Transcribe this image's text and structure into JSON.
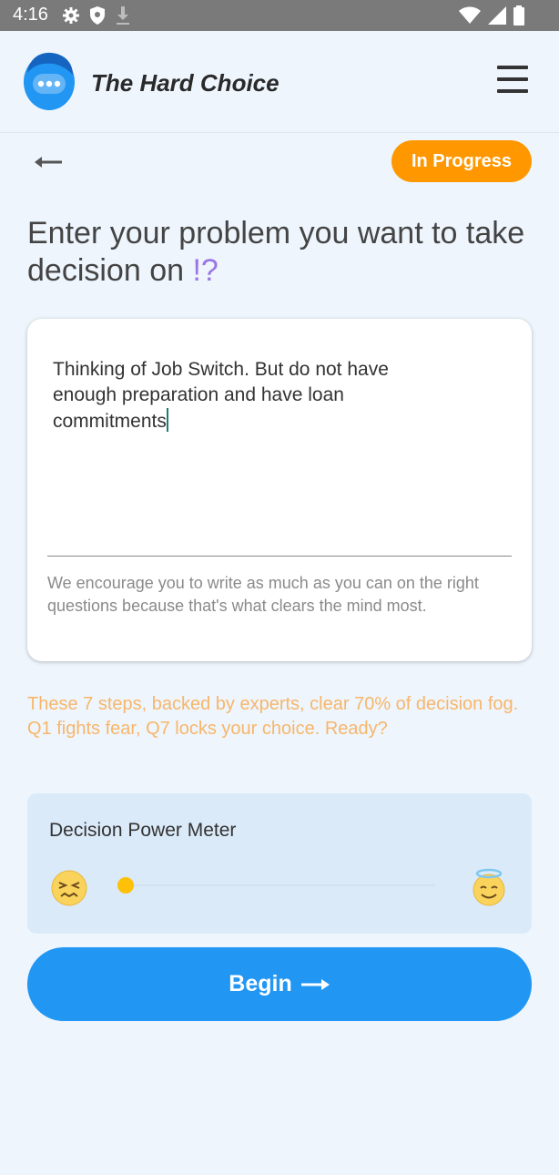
{
  "status_bar": {
    "time": "4:16",
    "icons_left": [
      "gear-icon",
      "shield-icon",
      "download-icon"
    ],
    "icons_right": [
      "wifi-icon",
      "signal-icon",
      "battery-icon"
    ]
  },
  "header": {
    "app_title": "The Hard Choice",
    "logo_icon": "chat-face-logo",
    "menu_icon": "hamburger-menu-icon"
  },
  "toolbar": {
    "back_icon": "back-arrow-icon",
    "status_label": "In Progress"
  },
  "question": {
    "text": "Enter your problem you want to take decision on",
    "accent": "!?"
  },
  "problem_input": {
    "value": "Thinking of Job Switch. But do not have enough preparation and have loan commitments",
    "helper": "We encourage you to write as much as you can on the right questions because that's what clears the mind most."
  },
  "info": {
    "text": "These 7 steps, backed by experts, clear 70% of decision fog. Q1 fights fear, Q7 locks your choice. Ready?"
  },
  "meter": {
    "title": "Decision Power Meter",
    "left_emoji": "confounded-face-icon",
    "right_emoji": "smiling-halo-face-icon",
    "level": 0
  },
  "begin_button": {
    "label": "Begin"
  },
  "colors": {
    "primary": "#2196f3",
    "badge": "#ff9800",
    "accent": "#9b74e6",
    "info_text": "#f7b66a",
    "background": "#eef5fd"
  }
}
